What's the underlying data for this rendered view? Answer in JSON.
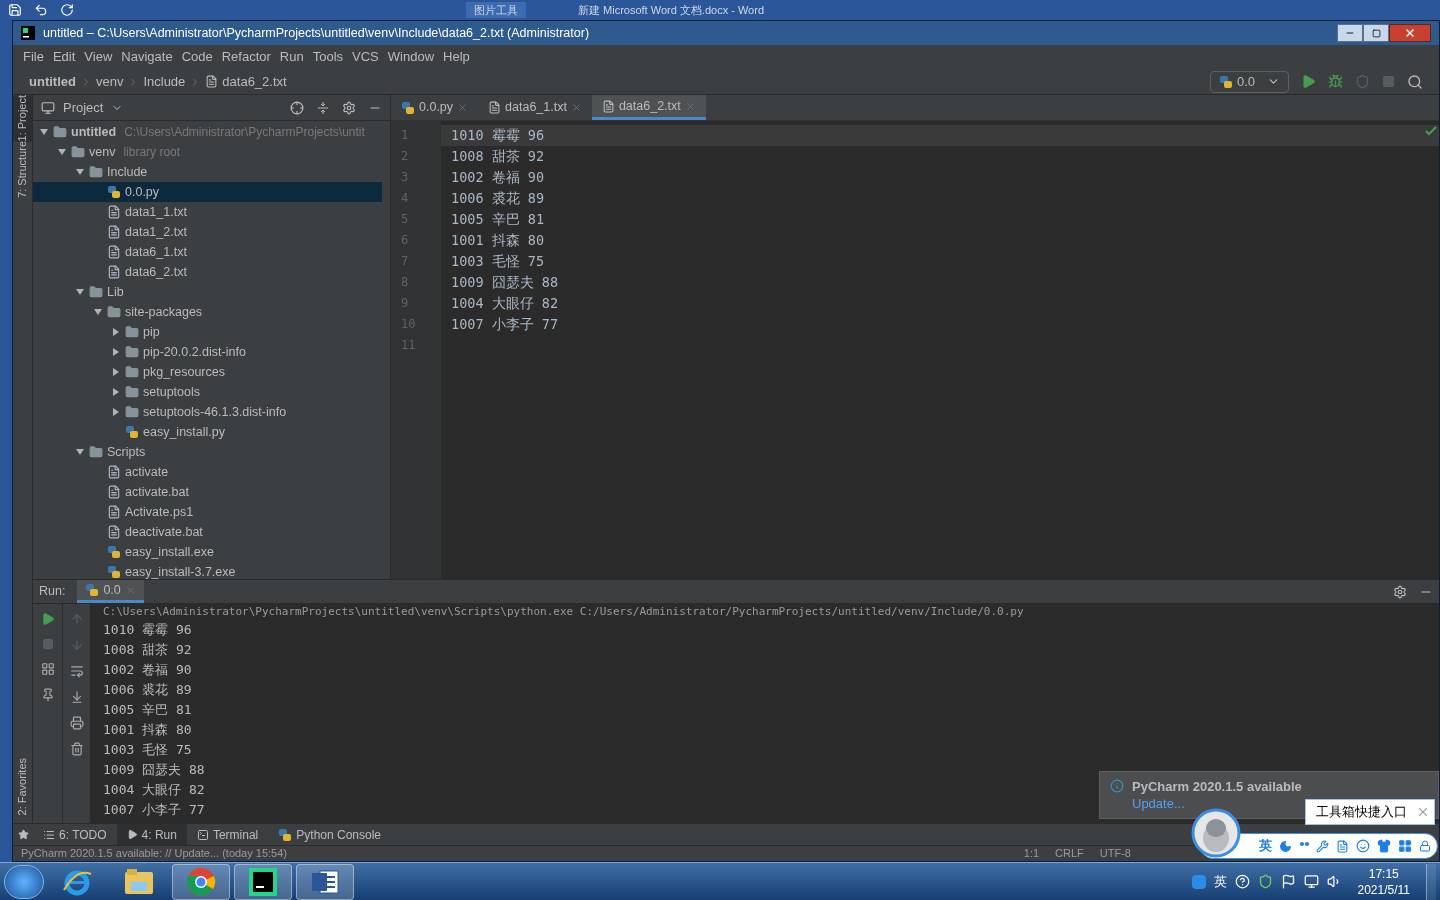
{
  "background_window": {
    "ribbon_tab": "图片工具",
    "title": "新建 Microsoft Word 文档.docx - Word"
  },
  "window": {
    "title": "untitled – C:\\Users\\Administrator\\PycharmProjects\\untitled\\venv\\Include\\data6_2.txt (Administrator)"
  },
  "menu": [
    "File",
    "Edit",
    "View",
    "Navigate",
    "Code",
    "Refactor",
    "Run",
    "Tools",
    "VCS",
    "Window",
    "Help"
  ],
  "breadcrumb": [
    {
      "label": "untitled",
      "kind": "project"
    },
    {
      "label": "venv",
      "kind": "folder"
    },
    {
      "label": "Include",
      "kind": "folder"
    },
    {
      "label": "data6_2.txt",
      "kind": "text"
    }
  ],
  "run_config": "0.0",
  "left_strip": [
    {
      "label": "1: Project",
      "selected": true
    },
    {
      "label": "7: Structure",
      "selected": false
    }
  ],
  "left_strip_bottom": [
    {
      "label": "2: Favorites",
      "selected": false
    }
  ],
  "project_panel": {
    "title": "Project",
    "tree": [
      {
        "name": "untitled",
        "kind": "root",
        "hint": "C:\\Users\\Administrator\\PycharmProjects\\untit",
        "expanded": true,
        "selected": false,
        "children": [
          {
            "name": "venv",
            "kind": "folder",
            "hint": "library root",
            "expanded": true,
            "selected": false,
            "children": [
              {
                "name": "Include",
                "kind": "folder",
                "expanded": true,
                "selected": false,
                "children": [
                  {
                    "name": "0.0.py",
                    "kind": "python",
                    "selected": true
                  },
                  {
                    "name": "data1_1.txt",
                    "kind": "text",
                    "selected": false
                  },
                  {
                    "name": "data1_2.txt",
                    "kind": "text",
                    "selected": false
                  },
                  {
                    "name": "data6_1.txt",
                    "kind": "text",
                    "selected": false
                  },
                  {
                    "name": "data6_2.txt",
                    "kind": "text",
                    "selected": false
                  }
                ]
              },
              {
                "name": "Lib",
                "kind": "folder",
                "expanded": true,
                "selected": false,
                "children": [
                  {
                    "name": "site-packages",
                    "kind": "folder",
                    "expanded": true,
                    "selected": false,
                    "children": [
                      {
                        "name": "pip",
                        "kind": "folder",
                        "expanded": false,
                        "selected": false
                      },
                      {
                        "name": "pip-20.0.2.dist-info",
                        "kind": "folder",
                        "expanded": false,
                        "selected": false
                      },
                      {
                        "name": "pkg_resources",
                        "kind": "folder",
                        "expanded": false,
                        "selected": false
                      },
                      {
                        "name": "setuptools",
                        "kind": "folder",
                        "expanded": false,
                        "selected": false
                      },
                      {
                        "name": "setuptools-46.1.3.dist-info",
                        "kind": "folder",
                        "expanded": false,
                        "selected": false
                      },
                      {
                        "name": "easy_install.py",
                        "kind": "python",
                        "selected": false
                      }
                    ]
                  }
                ]
              },
              {
                "name": "Scripts",
                "kind": "folder",
                "expanded": true,
                "selected": false,
                "children": [
                  {
                    "name": "activate",
                    "kind": "text",
                    "selected": false
                  },
                  {
                    "name": "activate.bat",
                    "kind": "text",
                    "selected": false
                  },
                  {
                    "name": "Activate.ps1",
                    "kind": "text",
                    "selected": false
                  },
                  {
                    "name": "deactivate.bat",
                    "kind": "text",
                    "selected": false
                  },
                  {
                    "name": "easy_install.exe",
                    "kind": "exe",
                    "selected": false
                  },
                  {
                    "name": "easy_install-3.7.exe",
                    "kind": "exe",
                    "selected": false
                  }
                ]
              }
            ]
          }
        ]
      }
    ]
  },
  "editor_tabs": [
    {
      "label": "0.0.py",
      "kind": "python",
      "selected": false
    },
    {
      "label": "data6_1.txt",
      "kind": "text",
      "selected": false
    },
    {
      "label": "data6_2.txt",
      "kind": "text",
      "selected": true
    }
  ],
  "editor_lines": [
    {
      "number": "1",
      "text": "1010 霉霉 96",
      "current": true
    },
    {
      "number": "2",
      "text": "1008 甜茶 92",
      "current": false
    },
    {
      "number": "3",
      "text": "1002 卷福 90",
      "current": false
    },
    {
      "number": "4",
      "text": "1006 裘花 89",
      "current": false
    },
    {
      "number": "5",
      "text": "1005 辛巴 81",
      "current": false
    },
    {
      "number": "6",
      "text": "1001 抖森 80",
      "current": false
    },
    {
      "number": "7",
      "text": "1003 毛怪 75",
      "current": false
    },
    {
      "number": "8",
      "text": "1009 囧瑟夫 88",
      "current": false
    },
    {
      "number": "9",
      "text": "1004 大眼仔 82",
      "current": false
    },
    {
      "number": "10",
      "text": "1007 小李子 77",
      "current": false
    },
    {
      "number": "11",
      "current": false
    }
  ],
  "run_panel": {
    "label": "Run:",
    "tab": "0.0",
    "output": [
      "C:\\Users\\Administrator\\PycharmProjects\\untitled\\venv\\Scripts\\python.exe C:/Users/Administrator/PycharmProjects/untitled/venv/Include/0.0.py",
      "1010 霉霉 96",
      "1008 甜茶 92",
      "1002 卷福 90",
      "1006 裘花 89",
      "1005 辛巴 81",
      "1001 抖森 80",
      "1003 毛怪 75",
      "1009 囧瑟夫 88",
      "1004 大眼仔 82",
      "1007 小李子 77"
    ]
  },
  "bottom_tabs": [
    {
      "label": "6: TODO",
      "kind": "todo",
      "selected": false
    },
    {
      "label": "4: Run",
      "kind": "run",
      "selected": true
    },
    {
      "label": "Terminal",
      "kind": "terminal",
      "selected": false
    },
    {
      "label": "Python Console",
      "kind": "console",
      "selected": false
    }
  ],
  "status_bar": {
    "message": "PyCharm 2020.1.5 available: // Update... (today 15:54)",
    "position": "1:1",
    "line_separator": "CRLF",
    "encoding": "UTF-8"
  },
  "notification": {
    "title": "PyCharm 2020.1.5 available",
    "link": "Update..."
  },
  "qq_toolbar": {
    "tooltip": "工具箱快捷入口",
    "input_mode": "英"
  },
  "taskbar": {
    "apps": [
      {
        "kind": "ie",
        "running": false
      },
      {
        "kind": "explorer",
        "running": false
      },
      {
        "kind": "chrome",
        "running": true
      },
      {
        "kind": "pycharm",
        "running": true
      },
      {
        "kind": "word",
        "running": true
      }
    ],
    "language": "英",
    "time": "17:15",
    "date": "2021/5/11"
  }
}
